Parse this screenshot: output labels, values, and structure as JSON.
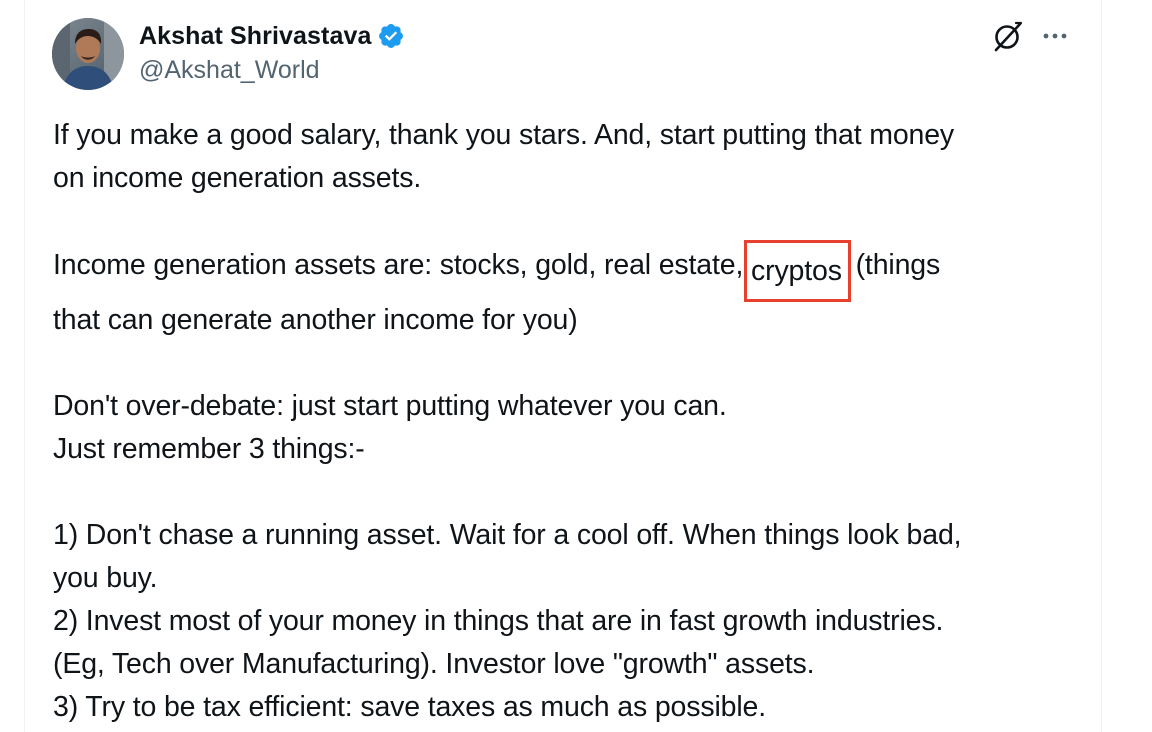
{
  "author": {
    "display_name": "Akshat Shrivastava",
    "handle": "@Akshat_World",
    "verified": true
  },
  "icons": {
    "verified": "verified-badge-icon",
    "grok": "grok-icon",
    "more": "more-options-icon"
  },
  "tweet": {
    "para1": {
      "line1": "If you make a good salary, thank you stars. And, start putting that money",
      "line2": "on income generation assets."
    },
    "para2": {
      "line1_before": "Income generation assets are: stocks, gold, real estate, ",
      "highlight": "cryptos",
      "line1_after": " (things",
      "line2": "that can generate another income for you)"
    },
    "para3": {
      "line1": "Don't over-debate: just start putting whatever you can.",
      "line2": "Just remember 3 things:-"
    },
    "para4": {
      "line1": "1) Don't chase a running asset. Wait for a cool off. When things look bad,",
      "line2": "you buy.",
      "line3": "2) Invest most of your money in things that are in fast growth industries.",
      "line4": "(Eg, Tech over Manufacturing). Investor love \"growth\" assets.",
      "line5": "3) Try to be tax efficient: save taxes as much as possible."
    }
  },
  "colors": {
    "text": "#0f1419",
    "secondary_text": "#536471",
    "verified_blue": "#1d9bf0",
    "highlight_box": "#e8402f"
  }
}
